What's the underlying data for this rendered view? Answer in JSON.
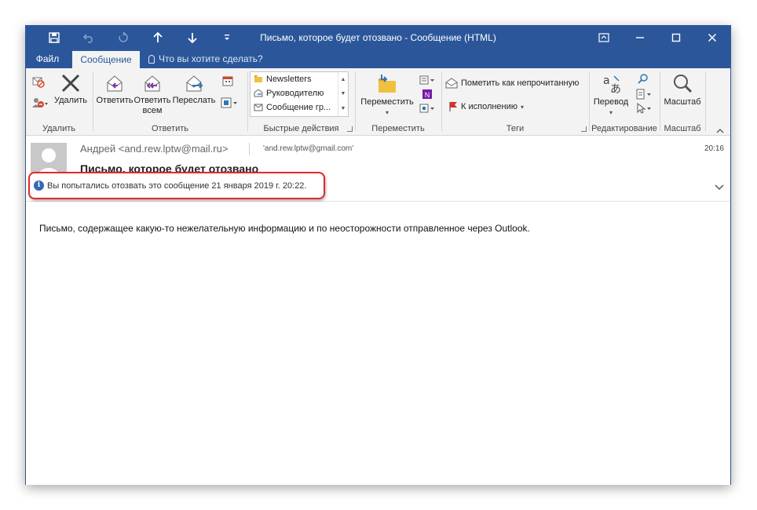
{
  "window": {
    "title": "Письмо, которое будет отозвано - Сообщение (HTML)"
  },
  "qat": {
    "save_icon": "save-icon",
    "undo_icon": "undo-icon",
    "redo_icon": "redo-icon",
    "up_icon": "arrow-up-icon",
    "down_icon": "arrow-down-icon",
    "customize_icon": "customize-qat-icon"
  },
  "window_controls": {
    "ribbon_options": "ribbon-display-options-icon",
    "minimize": "minimize-icon",
    "maximize": "maximize-icon",
    "close": "close-icon"
  },
  "tabs": {
    "file": "Файл",
    "message": "Сообщение",
    "tell_me": "Что вы хотите сделать?"
  },
  "ribbon": {
    "delete_group": {
      "label": "Удалить",
      "delete_button": "Удалить"
    },
    "respond_group": {
      "label": "Ответить",
      "reply": "Ответить",
      "reply_all_line1": "Ответить",
      "reply_all_line2": "всем",
      "forward": "Переслать"
    },
    "quick_steps": {
      "label": "Быстрые действия",
      "items": [
        "Newsletters",
        "Руководителю",
        "Сообщение гр..."
      ]
    },
    "move_group": {
      "label": "Переместить",
      "move_button": "Переместить"
    },
    "tags_group": {
      "label": "Теги",
      "mark_unread": "Пометить как непрочитанную",
      "follow_up": "К исполнению"
    },
    "editing_group": {
      "label": "Редактирование",
      "translate": "Перевод"
    },
    "zoom_group": {
      "label": "Масштаб",
      "zoom_button": "Масштаб"
    }
  },
  "message": {
    "sender": "Андрей <and.rew.lptw@mail.ru>",
    "recipient": "'and.rew.lptw@gmail.com'",
    "time": "20:16",
    "subject": "Письмо, которое будет отозвано",
    "info_text": "Вы попытались отозвать это сообщение 21 января 2019 г. 20:22.",
    "body": "Письмо, содержащее какую-то нежелательную информацию и по неосторожности отправленное через Outlook."
  },
  "colors": {
    "accent": "#2b579a",
    "highlight": "#e02a2a",
    "info_icon": "#3768b0"
  }
}
